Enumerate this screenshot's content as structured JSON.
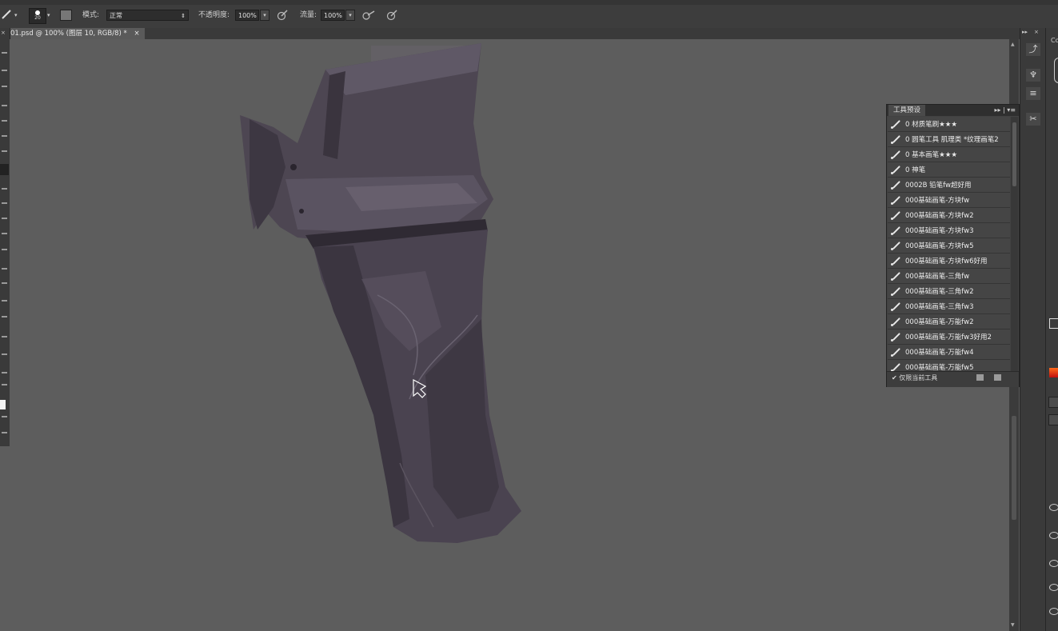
{
  "options_bar": {
    "brush_size": "20",
    "mode_label": "模式:",
    "mode_value": "正常",
    "opacity_label": "不透明度:",
    "opacity_value": "100%",
    "flow_label": "流量:",
    "flow_value": "100%"
  },
  "document_tab": {
    "title": "01.psd @ 100% (图层 10, RGB/8) *",
    "close": "×"
  },
  "tool_presets_panel": {
    "tab_label": "工具预设",
    "items": [
      "0 材质笔刷★★★",
      "0 圆笔工具 肌理类 *纹理画笔2",
      "0 基本画笔★★★",
      "0 神笔",
      "0002B 铅笔fw超好用",
      "000基础画笔-方块fw",
      "000基础画笔-方块fw2",
      "000基础画笔-方块fw3",
      "000基础画笔-方块fw5",
      "000基础画笔-方块fw6好用",
      "000基础画笔-三角fw",
      "000基础画笔-三角fw2",
      "000基础画笔-三角fw3",
      "000基础画笔-万能fw2",
      "000基础画笔-万能fw3好用2",
      "000基础画笔-万能fw4",
      "000基础画笔-万能fw5"
    ],
    "current_tool_only": "仅限当前工具"
  },
  "right_dock": {
    "top_label": "Co"
  },
  "colors": {
    "canvas_bg": "#5d5d5d",
    "armor_main": "#4a4350",
    "armor_dark": "#2f2a33",
    "armor_light": "#6e6775"
  }
}
